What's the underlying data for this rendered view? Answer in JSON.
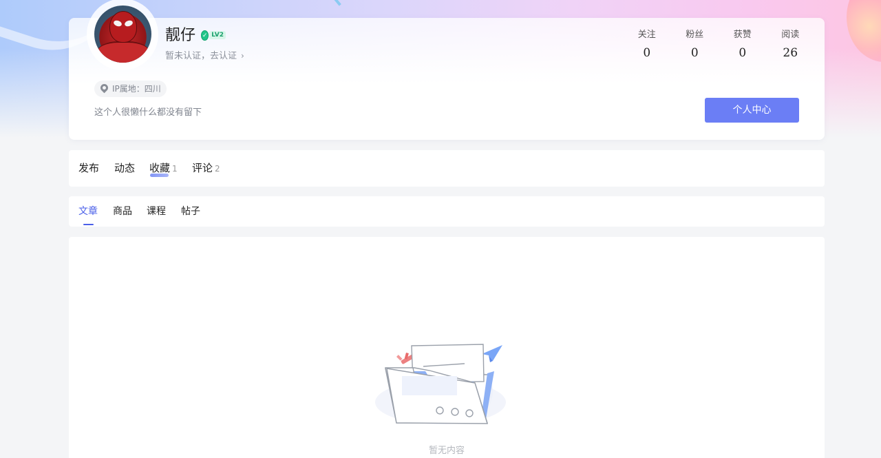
{
  "profile": {
    "name": "靓仔",
    "level": "LV2",
    "verify_text": "暂未认证，去认证",
    "ip_location": "IP属地：四川",
    "bio": "这个人很懒什么都没有留下",
    "center_button": "个人中心"
  },
  "stats": [
    {
      "label": "关注",
      "value": "0"
    },
    {
      "label": "粉丝",
      "value": "0"
    },
    {
      "label": "获赞",
      "value": "0"
    },
    {
      "label": "阅读",
      "value": "26"
    }
  ],
  "main_tabs": [
    {
      "label": "发布",
      "count": ""
    },
    {
      "label": "动态",
      "count": ""
    },
    {
      "label": "收藏",
      "count": "1"
    },
    {
      "label": "评论",
      "count": "2"
    }
  ],
  "sub_tabs": [
    {
      "label": "文章"
    },
    {
      "label": "商品"
    },
    {
      "label": "课程"
    },
    {
      "label": "帖子"
    }
  ],
  "empty_state": {
    "text": "暂无内容",
    "icon": "empty-folder-icon"
  },
  "colors": {
    "accent": "#6b7ef5",
    "active_tab": "#4a5fe8",
    "level_green": "#23c58a"
  }
}
